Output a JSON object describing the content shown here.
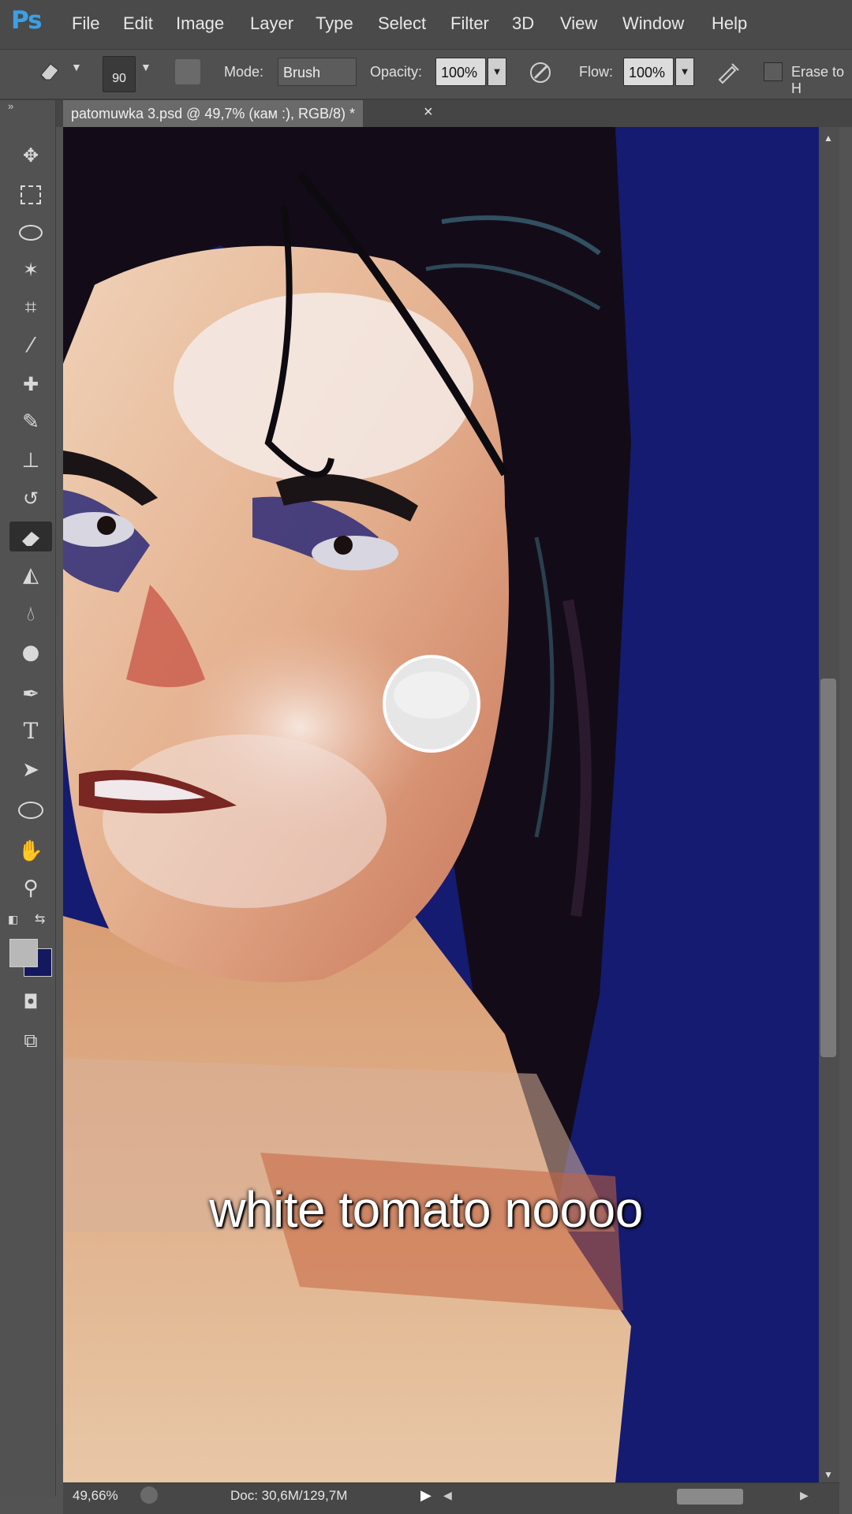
{
  "app": {
    "logo": "Ps"
  },
  "menu": [
    "File",
    "Edit",
    "Image",
    "Layer",
    "Type",
    "Select",
    "Filter",
    "3D",
    "View",
    "Window",
    "Help"
  ],
  "options": {
    "brush_size": "90",
    "mode_label": "Mode:",
    "mode_value": "Brush",
    "opacity_label": "Opacity:",
    "opacity_value": "100%",
    "flow_label": "Flow:",
    "flow_value": "100%",
    "erase_label": "Erase to H"
  },
  "document": {
    "tab_title": "patomuwka 3.psd @ 49,7% (кам :), RGB/8) *",
    "close_glyph": "×"
  },
  "status": {
    "zoom": "49,66%",
    "doc_size": "Doc: 30,6M/129,7M"
  },
  "caption": "white tomato noooo",
  "colors": {
    "foreground": "#b8b8b8",
    "background": "#14185e",
    "canvas_blue": "#151b70"
  }
}
